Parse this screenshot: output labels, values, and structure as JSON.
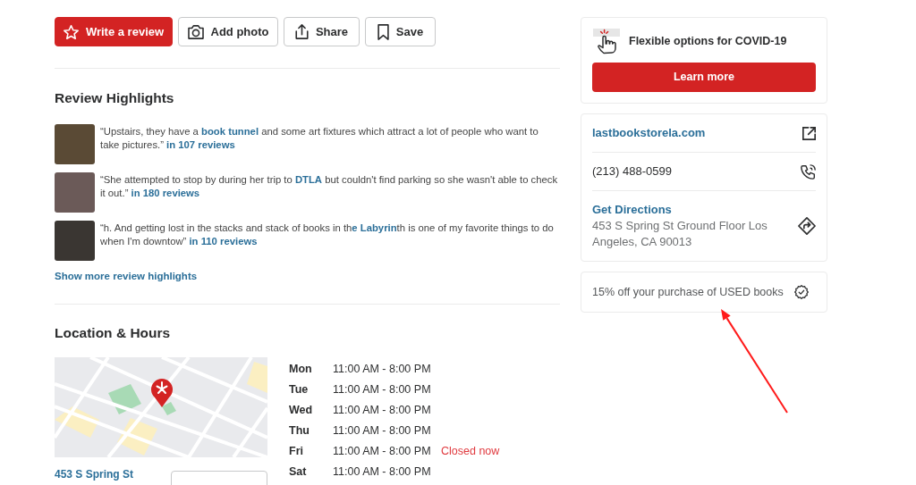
{
  "action_buttons": [
    {
      "kind": "review",
      "label": "Write a review"
    },
    {
      "kind": "photo",
      "label": "Add photo"
    },
    {
      "kind": "share",
      "label": "Share"
    },
    {
      "kind": "save",
      "label": "Save"
    }
  ],
  "review_highlights": {
    "title": "Review Highlights",
    "items": [
      {
        "quote": "“Upstairs, they have a **book tunnel** and some art fixtures which attract a lot of people who want to take pictures.”",
        "count_link": "in 107 reviews"
      },
      {
        "quote": "“She attempted to stop by during her trip to **DTLA** but couldn't find parking so she wasn't able to check it out.”",
        "count_link": "in 180 reviews"
      },
      {
        "quote": "“h. And getting lost in the stacks and stack of books in th**e Labyrin**th is one of my favorite things to do when I'm downtow”",
        "count_link": "in 110 reviews"
      }
    ],
    "more_link": "Show more review highlights"
  },
  "location_hours": {
    "title": "Location & Hours",
    "address_link": "453 S Spring St",
    "hours": [
      {
        "day": "Mon",
        "time": "11:00 AM - 8:00 PM"
      },
      {
        "day": "Tue",
        "time": "11:00 AM - 8:00 PM"
      },
      {
        "day": "Wed",
        "time": "11:00 AM - 8:00 PM"
      },
      {
        "day": "Thu",
        "time": "11:00 AM - 8:00 PM"
      },
      {
        "day": "Fri",
        "time": "11:00 AM - 8:00 PM",
        "note": "Closed now"
      },
      {
        "day": "Sat",
        "time": "11:00 AM - 8:00 PM"
      }
    ]
  },
  "covid_card": {
    "title": "Flexible options for COVID-19",
    "button": "Learn more"
  },
  "contact_card": {
    "rows": [
      {
        "kind": "website",
        "text": "lastbookstorela.com"
      },
      {
        "kind": "phone",
        "text": "(213) 488-0599"
      },
      {
        "kind": "directions",
        "link": "Get Directions",
        "text": "453 S Spring St Ground Floor Los Angeles, CA 90013"
      }
    ]
  },
  "offer_card": {
    "text": "15% off your purchase of USED books"
  },
  "annotations": [
    {
      "kind": "arrow"
    }
  ]
}
